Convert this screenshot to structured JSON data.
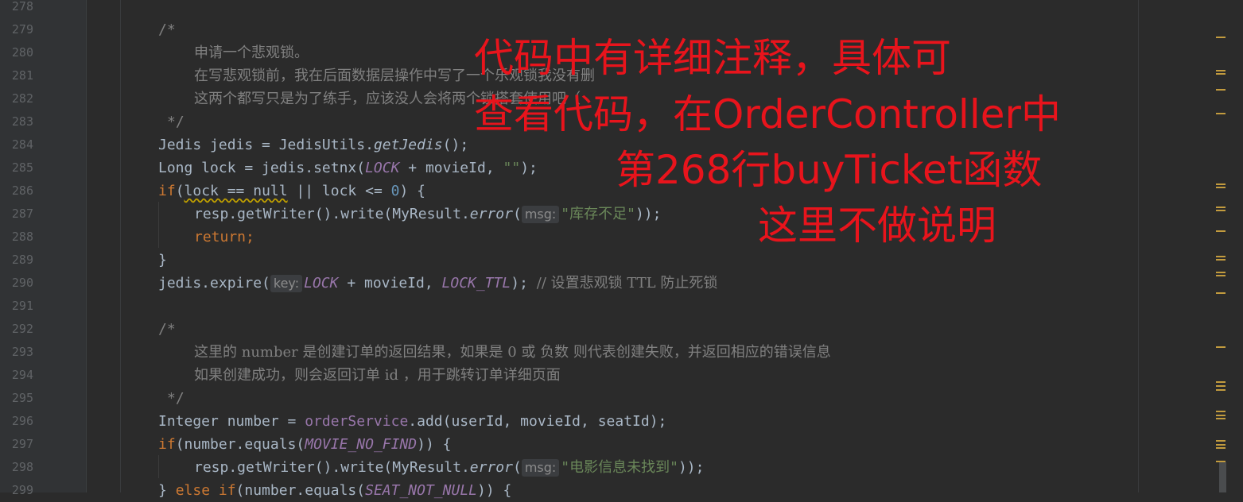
{
  "gutter": {
    "line_numbers": [
      "278",
      "279",
      "280",
      "281",
      "282",
      "283",
      "284",
      "285",
      "286",
      "287",
      "288",
      "289",
      "290",
      "291",
      "292",
      "293",
      "294",
      "295",
      "296",
      "297",
      "298",
      "299"
    ]
  },
  "code": {
    "c279": "/*",
    "c280": "申请一个悲观锁。",
    "c281": "在写悲观锁前，我在后面数据层操作中写了一个乐观锁我没有删",
    "c282": "这两个都写只是为了练手，应该没人会将两个锁搭套使用吧（",
    "c283": "*/",
    "c284a": "Jedis jedis = JedisUtils.",
    "c284b": "getJedis",
    "c284c": "();",
    "c285a": "Long lock = jedis.setnx(",
    "c285b": "LOCK",
    "c285c": " + movieId, ",
    "c285d": "\"\"",
    "c285e": ");",
    "c286a": "if",
    "c286b": "(",
    "c286c": "lock == null",
    "c286d": " || lock <= ",
    "c286e": "0",
    "c286f": ") {",
    "c287a": "resp.getWriter().write(MyResult.",
    "c287b": "error",
    "c287c": "(",
    "c287hint": "msg:",
    "c287d": "\"库存不足\"",
    "c287e": "));",
    "c288a": "return",
    "c288b": ";",
    "c289": "}",
    "c290a": "jedis.expire(",
    "c290hint": "key:",
    "c290b": "LOCK",
    "c290c": " + movieId, ",
    "c290d": "LOCK_TTL",
    "c290e": "); ",
    "c290f": "// 设置悲观锁 TTL 防止死锁",
    "c292": "/*",
    "c293": "这里的 number 是创建订单的返回结果，如果是 0 或 负数 则代表创建失败，并返回相应的错误信息",
    "c294": "如果创建成功，则会返回订单 id ，用于跳转订单详细页面",
    "c295": "*/",
    "c296a": "Integer number = ",
    "c296b": "orderService",
    "c296c": ".add(userId, movieId, seatId);",
    "c297a": "if",
    "c297b": "(number.equals(",
    "c297c": "MOVIE_NO_FIND",
    "c297d": ")) {",
    "c298a": "resp.getWriter().write(MyResult.",
    "c298b": "error",
    "c298c": "(",
    "c298hint": "msg:",
    "c298d": "\"电影信息未找到\"",
    "c298e": "));",
    "c299a": "} ",
    "c299b": "else if",
    "c299c": "(number.equals(",
    "c299d": "SEAT_NOT_NULL",
    "c299e": ")) {"
  },
  "annotation": {
    "line1": "代码中有详细注释，具体可",
    "line2": "查看代码，在OrderController中",
    "line3": "第268行buyTicket函数",
    "line4": "这里不做说明",
    "color": "#e8141c"
  },
  "colors": {
    "background": "#2b2b2b",
    "keyword": "#cc7832",
    "comment": "#808080",
    "constant": "#9876aa",
    "number": "#6897bb",
    "string": "#6a8759"
  }
}
